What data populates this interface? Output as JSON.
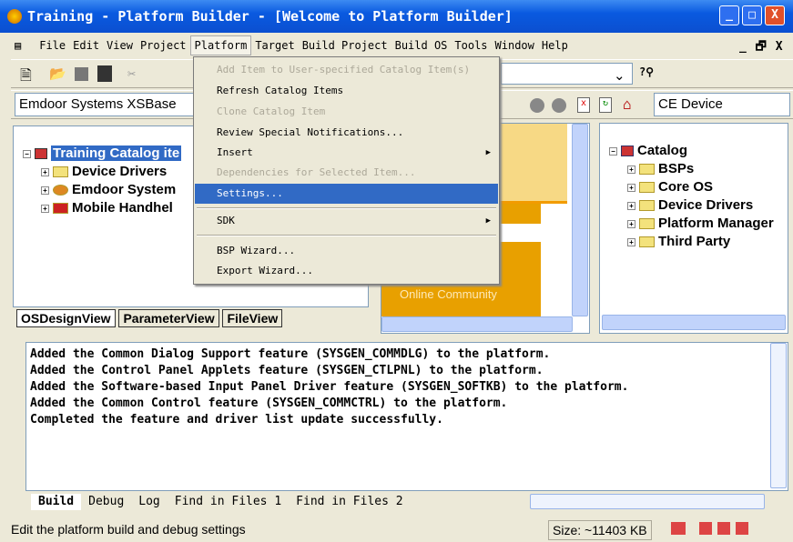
{
  "window": {
    "title": "Training - Platform Builder - [Welcome to Platform Builder]",
    "min": "_",
    "max": "□",
    "close": "X"
  },
  "menubar": [
    "File",
    "Edit",
    "View",
    "Project",
    "Platform",
    "Target",
    "Build Project",
    "Build OS",
    "Tools",
    "Window",
    "Help"
  ],
  "mdi_controls": [
    "_",
    "🗗",
    "X"
  ],
  "platform_menu": [
    {
      "label": "Add Item to User-specified Catalog Item(s)",
      "disabled": true
    },
    {
      "label": "Refresh Catalog Items"
    },
    {
      "label": "Clone Catalog Item",
      "disabled": true
    },
    {
      "label": "Review Special Notifications..."
    },
    {
      "label": "Insert",
      "submenu": true
    },
    {
      "label": "Dependencies for Selected Item...",
      "disabled": true
    },
    {
      "label": "Settings...",
      "highlighted": true
    },
    {
      "label": "SDK",
      "submenu": true
    },
    {
      "label": "BSP Wizard..."
    },
    {
      "label": "Export Wizard..."
    }
  ],
  "toolbar": {
    "platform_combo": "Emdoor Systems XSBase",
    "device_combo": "CE Device"
  },
  "left_panel": {
    "root": "Training Catalog ite",
    "items": [
      "Device Drivers",
      "Emdoor System",
      "Mobile Handhel"
    ],
    "tabs": [
      "OSDesignView",
      "ParameterView",
      "FileView"
    ]
  },
  "welcome": {
    "link": "Online Community"
  },
  "catalog": {
    "root": "Catalog",
    "items": [
      "BSPs",
      "Core OS",
      "Device Drivers",
      "Platform Manager",
      "Third Party"
    ]
  },
  "output": {
    "lines": [
      "Added the Common Dialog Support feature (SYSGEN_COMMDLG) to the platform.",
      "Added the Control Panel Applets feature (SYSGEN_CTLPNL) to the platform.",
      "Added the Software-based Input Panel Driver feature (SYSGEN_SOFTKB) to the platform.",
      "Added the Common Control feature (SYSGEN_COMMCTRL) to the platform.",
      "Completed the feature and driver list update successfully."
    ],
    "tabs": [
      "Build",
      "Debug",
      "Log",
      "Find in Files 1",
      "Find in Files 2"
    ]
  },
  "status": {
    "message": "Edit the platform build and debug settings",
    "size": "Size: ~11403 KB"
  }
}
